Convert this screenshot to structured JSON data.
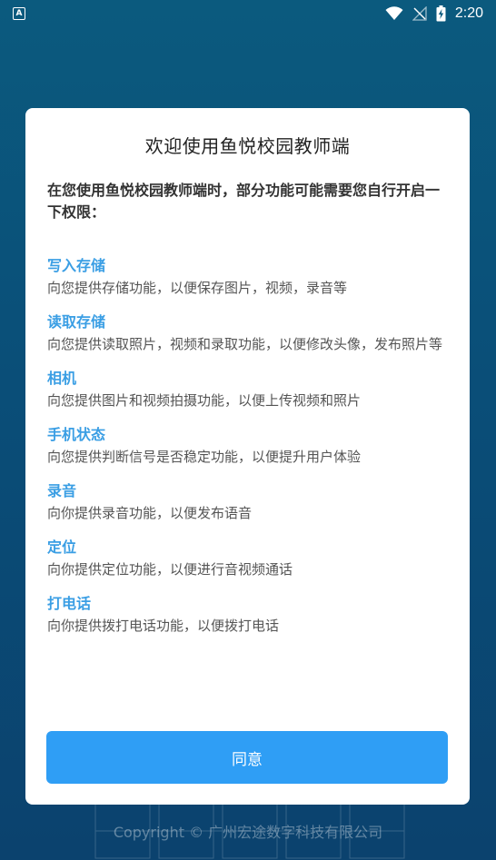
{
  "status_bar": {
    "app_icon_letter": "A",
    "time": "2:20"
  },
  "dialog": {
    "title": "欢迎使用鱼悦校园教师端",
    "intro": "在您使用鱼悦校园教师端时，部分功能可能需要您自行开启一下权限：",
    "permissions": [
      {
        "title": "写入存储",
        "desc": "向您提供存储功能，以便保存图片，视频，录音等"
      },
      {
        "title": "读取存储",
        "desc": "向您提供读取照片，视频和录取功能，以便修改头像，发布照片等"
      },
      {
        "title": "相机",
        "desc": "向您提供图片和视频拍摄功能，以便上传视频和照片"
      },
      {
        "title": "手机状态",
        "desc": "向您提供判断信号是否稳定功能，以便提升用户体验"
      },
      {
        "title": "录音",
        "desc": "向你提供录音功能，以便发布语音"
      },
      {
        "title": "定位",
        "desc": "向你提供定位功能，以便进行音视频通话"
      },
      {
        "title": "打电话",
        "desc": "向你提供拨打电话功能，以便拨打电话"
      }
    ],
    "agree_label": "同意"
  },
  "footer": {
    "copyright": "Copyright © 广州宏途数字科技有限公司"
  },
  "colors": {
    "accent": "#2f9ef5",
    "perm_title": "#3a9ee4",
    "background_top": "#0b5a7e",
    "background_bottom": "#0b426e"
  }
}
